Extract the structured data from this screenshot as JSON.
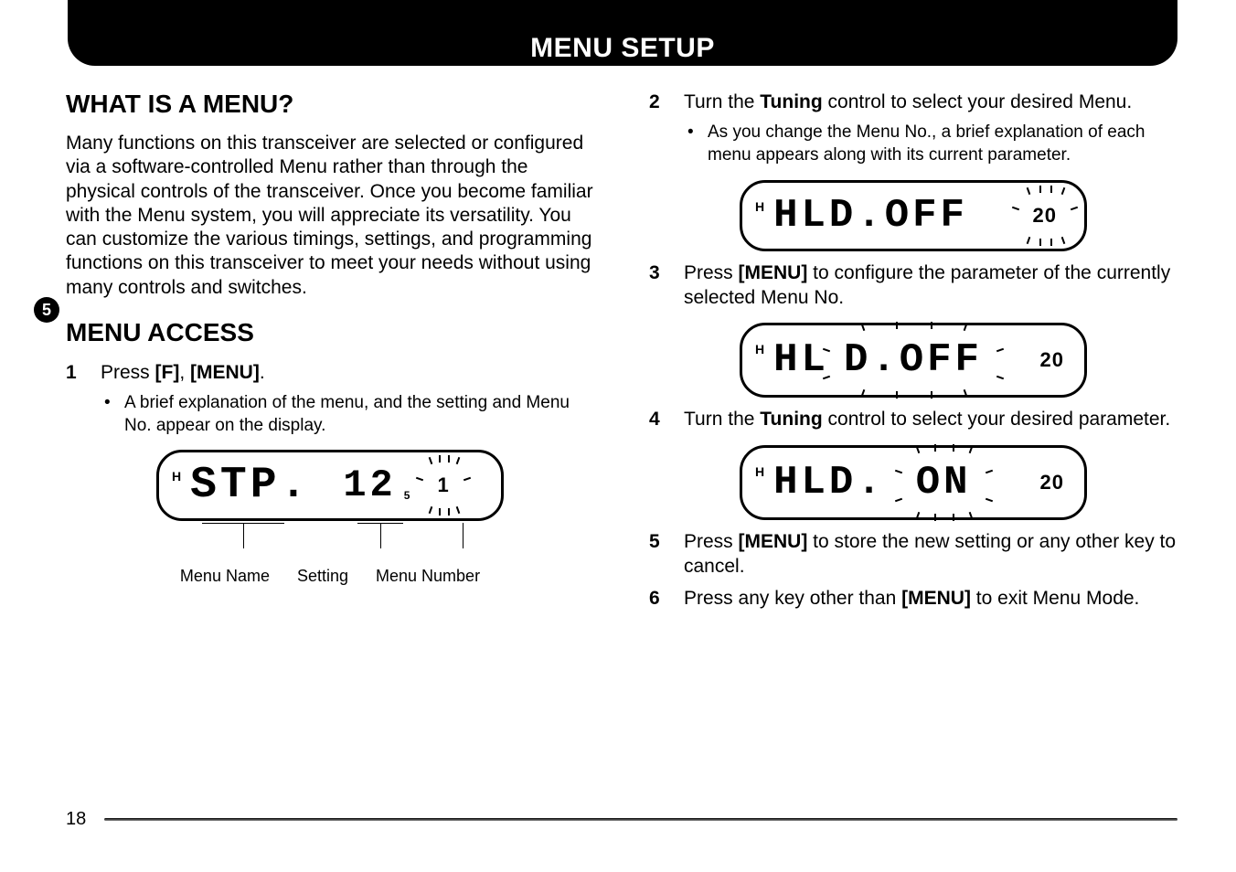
{
  "header": {
    "title": "MENU SETUP"
  },
  "chapter_tab": "5",
  "page_number": "18",
  "left": {
    "section1_title": "WHAT IS A MENU?",
    "section1_body": "Many functions on this transceiver are selected or configured via a software-controlled Menu rather than through the physical controls of the transceiver.  Once you become familiar with the Menu system, you will appreciate its versatility.  You can customize the various timings, settings, and programming functions on this transceiver to meet your needs without using many controls and switches.",
    "section2_title": "MENU ACCESS",
    "step1_num": "1",
    "step1_a": "Press ",
    "step1_b": "[F]",
    "step1_c": ", ",
    "step1_d": "[MENU]",
    "step1_e": ".",
    "bullet1": "A brief explanation of the menu, and the setting and Menu No. appear on the display.",
    "lcd1": {
      "h": "H",
      "name": "STP.",
      "setting": "12",
      "sub": "5",
      "menu_no": "1"
    },
    "callout_name": "Menu Name",
    "callout_setting": "Setting",
    "callout_menuno": "Menu Number"
  },
  "right": {
    "step2_num": "2",
    "step2_a": "Turn the ",
    "step2_b": "Tuning",
    "step2_c": " control to select your desired Menu.",
    "bullet2": "As you change the Menu No., a brief explanation of each menu appears along with its current parameter.",
    "lcd2": {
      "h": "H",
      "text": "HLD.OFF",
      "menu_no": "20"
    },
    "step3_num": "3",
    "step3_a": "Press ",
    "step3_b": "[MENU]",
    "step3_c": " to configure the parameter of the currently selected Menu No.",
    "lcd3": {
      "h": "H",
      "prefix": "HL",
      "blink": "D.OFF",
      "menu_no": "20"
    },
    "step4_num": "4",
    "step4_a": "Turn the ",
    "step4_b": "Tuning",
    "step4_c": " control to select your desired parameter.",
    "lcd4": {
      "h": "H",
      "prefix": "HLD.",
      "blink": "ON",
      "menu_no": "20"
    },
    "step5_num": "5",
    "step5_a": "Press ",
    "step5_b": "[MENU]",
    "step5_c": " to store the new setting or any other key to cancel.",
    "step6_num": "6",
    "step6_a": "Press any key other than ",
    "step6_b": "[MENU]",
    "step6_c": " to exit Menu Mode."
  }
}
